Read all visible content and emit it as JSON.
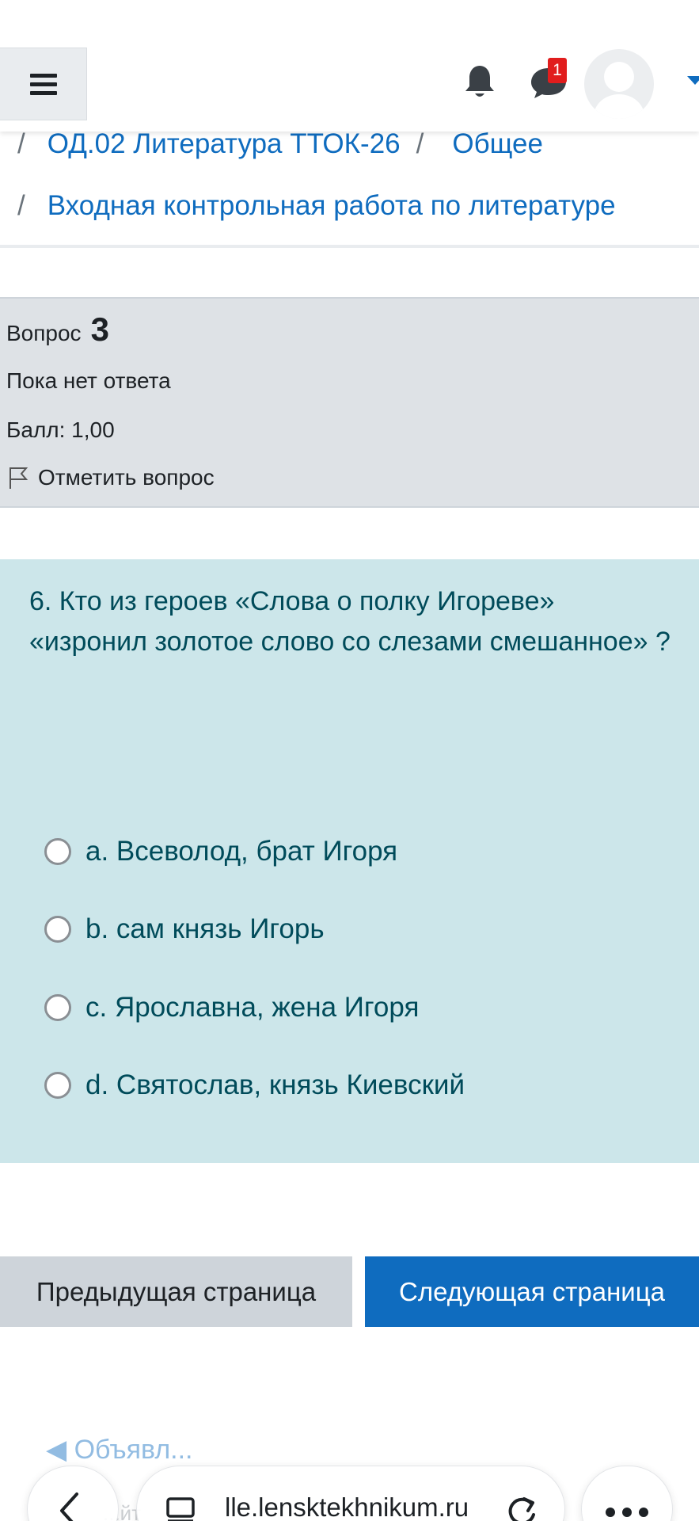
{
  "breadcrumb": {
    "items": [
      {
        "label": "ОД.02 Литература ТТОК-26"
      },
      {
        "label": "Общее"
      },
      {
        "label": "Входная контрольная работа по литературе"
      }
    ],
    "separator": "/"
  },
  "header": {
    "notification_badge": "1"
  },
  "question_info": {
    "label": "Вопрос",
    "number": "3",
    "status": "Пока нет ответа",
    "grade": "Балл: 1,00",
    "flag_label": "Отметить вопрос"
  },
  "question": {
    "text": "6. Кто из героев «Слова о полку Игореве» «изронил золотое слово со слезами смешанное» ?",
    "options": [
      {
        "label": "a. Всеволод, брат Игоря"
      },
      {
        "label": "b. сам князь Игорь"
      },
      {
        "label": "c. Ярославна, жена Игоря"
      },
      {
        "label": "d. Святослав, князь Киевский"
      }
    ]
  },
  "navigation": {
    "prev_label": "Предыдущая страница",
    "next_label": "Следующая страница"
  },
  "footer": {
    "faded_link": "◀ Объявл...",
    "faded_sub": "...йт"
  },
  "browser": {
    "url": "lle.lensktekhnikum.ru"
  },
  "colors": {
    "link": "#0f6cbf",
    "question_bg": "#cce6ea",
    "question_text": "#004b5a",
    "info_bg": "#dee2e6",
    "primary_button": "#0f6cbf",
    "secondary_button": "#ced4da",
    "badge": "#e11d1d"
  },
  "icons": [
    "hamburger-icon",
    "bell-icon",
    "chat-icon",
    "avatar",
    "flag-icon",
    "back-icon",
    "tabs-icon",
    "reload-icon",
    "more-icon"
  ]
}
